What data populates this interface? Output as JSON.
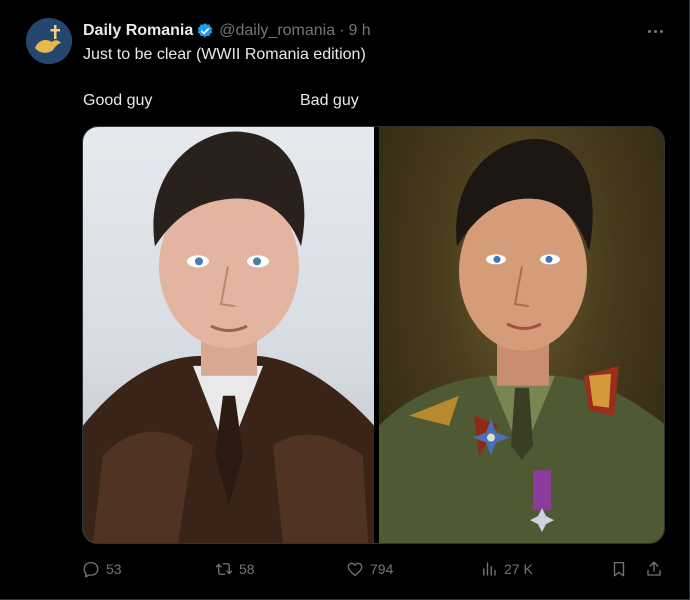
{
  "tweet": {
    "author": {
      "display_name": "Daily Romania",
      "handle": "@daily_romania",
      "verified": true,
      "avatar_icon": "bird-cross-avatar-icon"
    },
    "separator": "·",
    "time": "9 h",
    "more_icon": "more-dots-icon",
    "text": "Just to be clear (WWII Romania edition)",
    "captions": {
      "left": "Good guy",
      "right": "Bad guy"
    },
    "media": {
      "left_photo": "portrait-man-dark-coat",
      "right_photo": "portrait-young-man-military-uniform"
    },
    "stats": {
      "replies": "53",
      "reposts": "58",
      "likes": "794",
      "views": "27 K"
    },
    "icons": {
      "reply": "reply-icon",
      "repost": "repost-icon",
      "like": "heart-icon",
      "views": "views-chart-icon",
      "bookmark": "bookmark-icon",
      "share": "share-icon"
    },
    "colors": {
      "background": "#000000",
      "text_primary": "#e7e9ea",
      "text_secondary": "#71767b",
      "verified_blue": "#1d9bf0",
      "border": "#2f3336"
    }
  }
}
